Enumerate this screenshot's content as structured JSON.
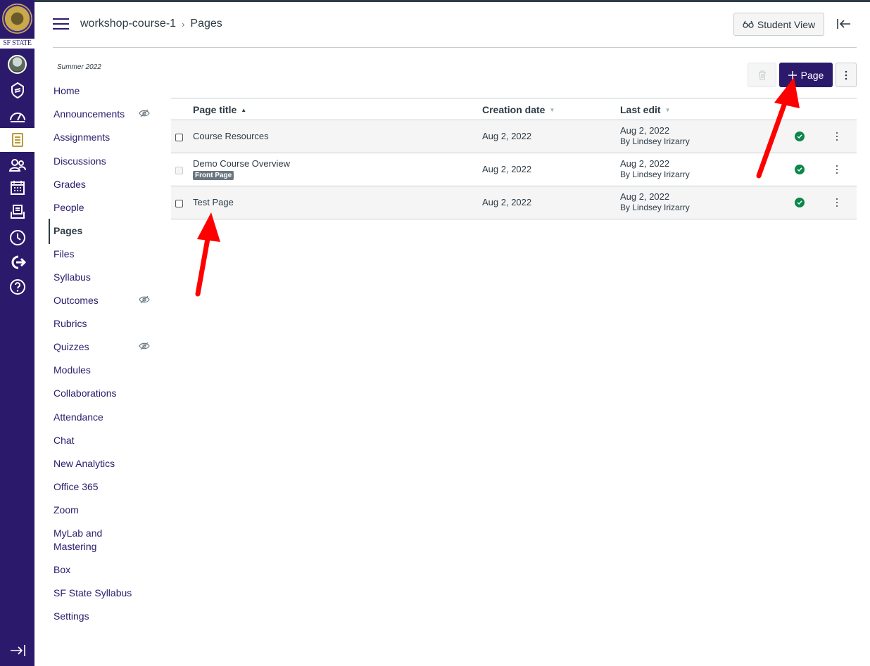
{
  "global_nav": {
    "logo_text": "SF STATE",
    "items": [
      {
        "name": "account",
        "icon": "user-avatar"
      },
      {
        "name": "admin",
        "icon": "shield-icon"
      },
      {
        "name": "dashboard",
        "icon": "dashboard-icon"
      },
      {
        "name": "courses",
        "icon": "courses-icon",
        "active": true
      },
      {
        "name": "groups",
        "icon": "groups-icon"
      },
      {
        "name": "calendar",
        "icon": "calendar-icon"
      },
      {
        "name": "inbox",
        "icon": "inbox-icon"
      },
      {
        "name": "history",
        "icon": "clock-icon"
      },
      {
        "name": "commons",
        "icon": "commons-icon"
      },
      {
        "name": "help",
        "icon": "help-icon"
      }
    ],
    "collapse_icon": "expand-icon"
  },
  "header": {
    "course": "workshop-course-1",
    "current": "Pages",
    "student_view": "Student View"
  },
  "course_nav": {
    "term": "Summer 2022",
    "items": [
      {
        "label": "Home"
      },
      {
        "label": "Announcements",
        "hidden": true
      },
      {
        "label": "Assignments"
      },
      {
        "label": "Discussions"
      },
      {
        "label": "Grades"
      },
      {
        "label": "People"
      },
      {
        "label": "Pages",
        "active": true
      },
      {
        "label": "Files"
      },
      {
        "label": "Syllabus"
      },
      {
        "label": "Outcomes",
        "hidden": true
      },
      {
        "label": "Rubrics"
      },
      {
        "label": "Quizzes",
        "hidden": true
      },
      {
        "label": "Modules"
      },
      {
        "label": "Collaborations"
      },
      {
        "label": "Attendance"
      },
      {
        "label": "Chat"
      },
      {
        "label": "New Analytics"
      },
      {
        "label": "Office 365"
      },
      {
        "label": "Zoom"
      },
      {
        "label": "MyLab and Mastering"
      },
      {
        "label": "Box"
      },
      {
        "label": "SF State Syllabus"
      },
      {
        "label": "Settings"
      }
    ]
  },
  "toolbar": {
    "add_page_label": "Page"
  },
  "table": {
    "columns": {
      "title": "Page title",
      "created": "Creation date",
      "last_edit": "Last edit"
    },
    "rows": [
      {
        "title": "Course Resources",
        "badge": "",
        "created": "Aug 2, 2022",
        "edit_date": "Aug 2, 2022",
        "edit_by": "By Lindsey Irizarry",
        "published": true
      },
      {
        "title": "Demo Course Overview",
        "badge": "Front Page",
        "created": "Aug 2, 2022",
        "edit_date": "Aug 2, 2022",
        "edit_by": "By Lindsey Irizarry",
        "published": true
      },
      {
        "title": "Test Page",
        "badge": "",
        "created": "Aug 2, 2022",
        "edit_date": "Aug 2, 2022",
        "edit_by": "By Lindsey Irizarry",
        "published": true
      }
    ]
  },
  "colors": {
    "brand_nav": "#2b1a6b",
    "published": "#0b874b",
    "annotation_arrow": "#ff0000"
  }
}
